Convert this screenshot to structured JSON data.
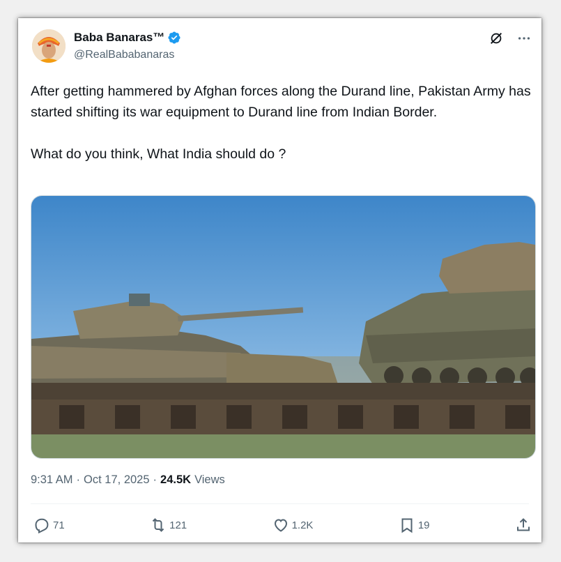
{
  "author": {
    "display_name": "Baba Banaras™",
    "handle": "@RealBababanaras",
    "verified_icon": "verified-badge-icon",
    "verified_color": "#1d9bf0"
  },
  "header_icons": [
    "grok-icon",
    "more-icon"
  ],
  "tweet": {
    "text": "After getting hammered by Afghan forces along the Durand line, Pakistan Army has started shifting its war equipment to Durand line from Indian Border.\n\nWhat do you think, What India should do ?"
  },
  "meta": {
    "time": "9:31 AM",
    "separator": "·",
    "date": "Oct 17, 2025",
    "views_count": "24.5K",
    "views_label": "Views"
  },
  "actions": {
    "replies": "71",
    "reposts": "121",
    "likes": "1.2K",
    "bookmarks": "19"
  },
  "colors": {
    "text": "#0f1419",
    "secondary": "#536471",
    "accent": "#1d9bf0"
  }
}
